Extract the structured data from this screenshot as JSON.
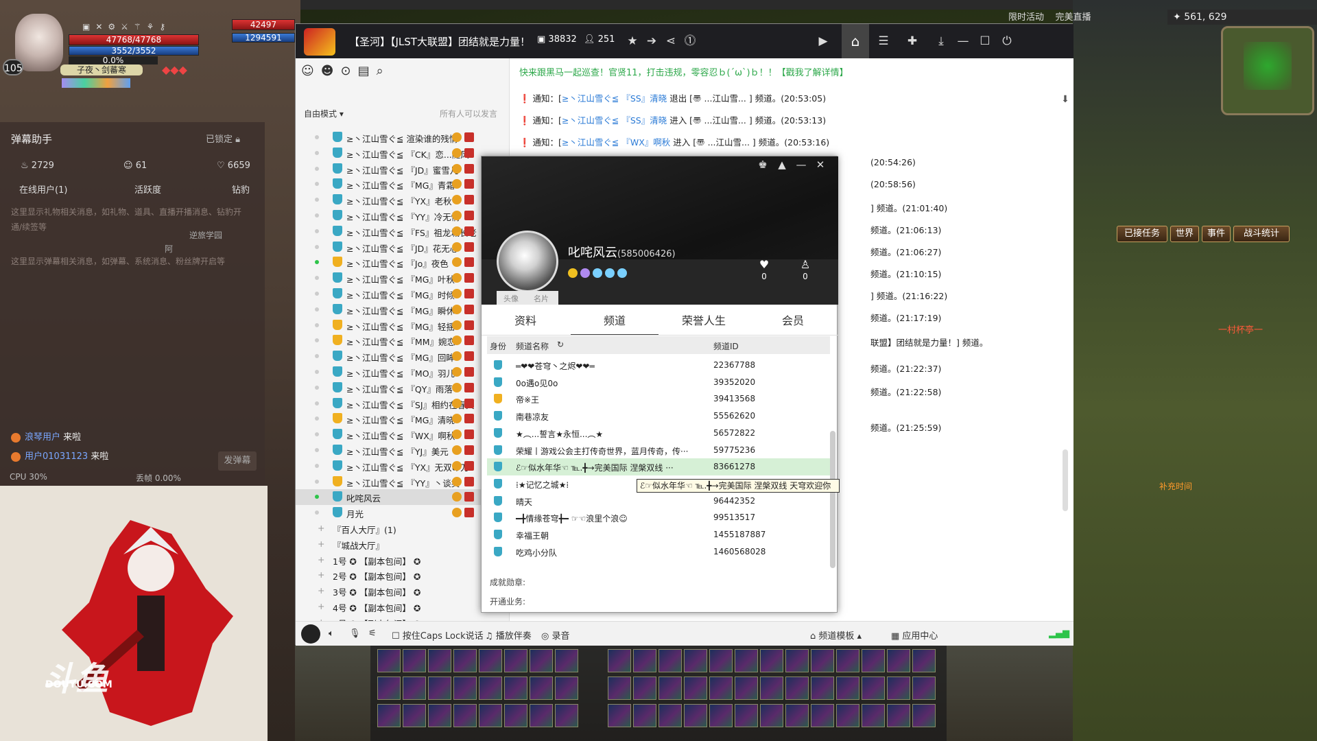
{
  "hud": {
    "hp": "47768/47768",
    "mp": "3552/3552",
    "xp": "0.0%",
    "level": "105",
    "player_name": "子夜丶剑蕃寒",
    "target_hp": "42497",
    "target_mp": "1294591",
    "coords": "561, 629",
    "top_labels": [
      "限时活动",
      "完美直播"
    ],
    "game_buttons": [
      "已接任务",
      "世界",
      "事件",
      "战斗统计"
    ]
  },
  "danmu": {
    "title": "弹幕助手",
    "lock": "已锁定",
    "stats": {
      "fire": "2729",
      "people": "61",
      "hearts": "6659"
    },
    "tabs": [
      "在线用户(1)",
      "活跃度",
      "钻豹"
    ],
    "gift_hint": "这里显示礼物相关消息，如礼物、道具、直播开播消息、钻豹开通/续签等",
    "gift_user": "逆旅学园",
    "gift_user2": "阿",
    "danmu_hint": "这里显示弹幕相关消息，如弹幕、系统消息、粉丝牌开启等",
    "joins": [
      {
        "user": "浪琴用户",
        "action": "来啦"
      },
      {
        "user": "用户01031123",
        "action": "来啦"
      }
    ],
    "send_button": "发弹幕",
    "cpu": "CPU 30%",
    "lost": "丢帧 0.00%",
    "watermark": "DOUYU.COM",
    "watermark_big": "斗鱼"
  },
  "client": {
    "title": "【圣河】【JLST大联盟】团结就是力量！",
    "channel_id": "38832",
    "online": "251",
    "marquee": "快来跟黑马一起巡查！官贤11，打击违规，零容忍ｂ(´ω`)ｂ！！【戳我了解详情】",
    "free_mode": "自由模式",
    "all_talk": "所有人可以发言",
    "users": [
      {
        "name": "≥丶江山雪ぐ≦ 渲染谁的残情",
        "gold": false,
        "on": false
      },
      {
        "name": "≥丶江山雪ぐ≦ 『CK』恋...随风",
        "gold": false,
        "on": false
      },
      {
        "name": "≥丶江山雪ぐ≦ 『JD』蜜雪儿",
        "gold": false,
        "on": false
      },
      {
        "name": "≥丶江山雪ぐ≦ 『MG』青霜",
        "gold": false,
        "on": false
      },
      {
        "name": "≥丶江山雪ぐ≦ 『YX』老秋",
        "gold": false,
        "on": false
      },
      {
        "name": "≥丶江山雪ぐ≦ 『YY』冷无情",
        "gold": false,
        "on": false
      },
      {
        "name": "≥丶江山雪ぐ≦ 『FS』祖龙城长老",
        "gold": false,
        "on": false
      },
      {
        "name": "≥丶江山雪ぐ≦ 『JD』花无心",
        "gold": false,
        "on": false
      },
      {
        "name": "≥丶江山雪ぐ≦ 『Jo』夜色",
        "gold": true,
        "on": true
      },
      {
        "name": "≥丶江山雪ぐ≦ 『MG』叶秋",
        "gold": false,
        "on": false
      },
      {
        "name": "≥丶江山雪ぐ≦ 『MG』时倾",
        "gold": false,
        "on": false
      },
      {
        "name": "≥丶江山雪ぐ≦ 『MG』瞬休",
        "gold": false,
        "on": false
      },
      {
        "name": "≥丶江山雪ぐ≦ 『MG』轻揺",
        "gold": true,
        "on": false
      },
      {
        "name": "≥丶江山雪ぐ≦ 『MM』婉恋",
        "gold": true,
        "on": false
      },
      {
        "name": "≥丶江山雪ぐ≦ 『MG』回眸",
        "gold": false,
        "on": false
      },
      {
        "name": "≥丶江山雪ぐ≦ 『MO』羽儿",
        "gold": false,
        "on": false
      },
      {
        "name": "≥丶江山雪ぐ≦ 『QY』雨落",
        "gold": false,
        "on": false
      },
      {
        "name": "≥丶江山雪ぐ≦ 『SJ』相约在春天",
        "gold": false,
        "on": false
      },
      {
        "name": "≥丶江山雪ぐ≦ 『MG』清晓",
        "gold": true,
        "on": false
      },
      {
        "name": "≥丶江山雪ぐ≦ 『WX』啊秋",
        "gold": false,
        "on": false
      },
      {
        "name": "≥丶江山雪ぐ≦ 『YJ』美元",
        "gold": false,
        "on": false
      },
      {
        "name": "≥丶江山雪ぐ≦ 『YX』无双の刀",
        "gold": false,
        "on": false
      },
      {
        "name": "≥丶江山雪ぐ≦ 『YY』丶谈笑",
        "gold": true,
        "on": false
      },
      {
        "name": "叱咤风云",
        "gold": false,
        "on": true,
        "sel": true
      },
      {
        "name": "月光",
        "gold": false,
        "on": false
      }
    ],
    "channels": [
      "『百人大厅』(1)",
      "『城战大厅』",
      "1号 ✪ 【副本包间】 ✪",
      "2号 ✪ 【副本包间】 ✪",
      "3号 ✪ 【副本包间】 ✪",
      "4号 ✪ 【副本包间】 ✪",
      "5号 ✪ 【副本包间】 ✪",
      "6号 ✪ 【副本包间】 ✪"
    ],
    "messages": [
      {
        "pre": "通知：[",
        "tag": "≥丶江山雪ぐ≦ 『SS』清晓",
        "post": " 退出 [〠    ...江山雪...         ] 频道。(20:53:05)"
      },
      {
        "pre": "通知：[",
        "tag": "≥丶江山雪ぐ≦ 『SS』清晓",
        "post": " 进入 [〠    ...江山雪...         ] 频道。(20:53:13)"
      },
      {
        "pre": "通知：[",
        "tag": "≥丶江山雪ぐ≦ 『WX』啊秋",
        "post": " 进入 [〠    ...江山雪...         ] 频道。(20:53:16)"
      }
    ],
    "side_msgs": [
      "(20:54:26)",
      "(20:58:56)",
      "] 频道。(21:01:40)",
      "频道。(21:06:13)",
      "频道。(21:06:27)",
      "频道。(21:10:15)",
      "] 频道。(21:16:22)",
      "频道。(21:17:19)",
      "联盟】团结就是力量！] 频道。",
      "频道。(21:22:37)",
      "频道。(21:22:58)",
      "频道。(21:25:59)"
    ],
    "bottom": {
      "caps": "按住Caps Lock说话",
      "music": "播放伴奏",
      "record": "录音",
      "template": "频道模板",
      "apps": "应用中心"
    }
  },
  "profile": {
    "name": "叱咤风云",
    "uid": "(585006426)",
    "photo_tabs": [
      "头像",
      "名片"
    ],
    "likes": "0",
    "fans": "0",
    "tabs": [
      "资料",
      "频道",
      "荣誉人生",
      "会员"
    ],
    "active_tab": "频道",
    "col_role": "身份",
    "col_name": "频道名称",
    "col_id": "频道ID",
    "rows": [
      {
        "name": "═❤❤苍穹丶之烬❤❤═",
        "id": "22367788",
        "gold": false
      },
      {
        "name": "0o遇o见0o",
        "id": "39352020",
        "gold": false
      },
      {
        "name": "帝※王",
        "id": "39413568",
        "gold": true
      },
      {
        "name": "          南巷凉友",
        "id": "55562620",
        "gold": false
      },
      {
        "name": "    ★︵...誓言★永恒...︵★",
        "id": "56572822",
        "gold": false
      },
      {
        "name": "荣耀丨游戏公会主打传奇世界，蓝月传奇，传···",
        "id": "59775236",
        "gold": false
      },
      {
        "name": "ℰ☞似水年华☜ ℡.╋→完美国际 涅槃双线 ···",
        "id": "83661278",
        "gold": false,
        "hl": true
      },
      {
        "name": "⁞★记忆之城★⁞",
        "id": "",
        "gold": false
      },
      {
        "name": "晴天",
        "id": "96442352",
        "gold": false
      },
      {
        "name": "━╋情缘苍穹╋━ ☞☜浪里个浪☺",
        "id": "99513517",
        "gold": false
      },
      {
        "name": "幸福王朝",
        "id": "1455187887",
        "gold": false
      },
      {
        "name": "吃鸡小分队",
        "id": "1460568028",
        "gold": false
      }
    ],
    "tooltip": "ℰ☞似水年华☜ ℡.╋→完美国际 涅槃双线 天穹欢迎你",
    "medal": "成就勋章:",
    "biz": "开通业务:"
  },
  "game_text": {
    "right1": "一村杯亭一",
    "right2": "补充时间"
  }
}
